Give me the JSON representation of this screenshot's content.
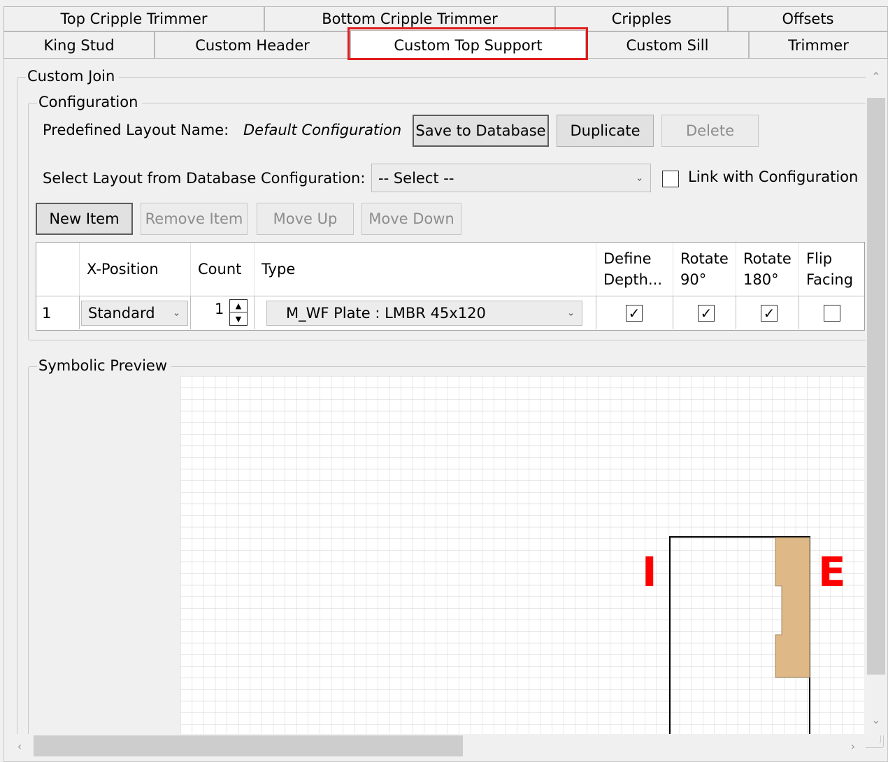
{
  "tabs_row1": [
    "Top Cripple Trimmer",
    "Bottom Cripple Trimmer",
    "Cripples",
    "Offsets"
  ],
  "tabs_row2": [
    "King Stud",
    "Custom Header",
    "Custom Top Support",
    "Custom Sill",
    "Trimmer"
  ],
  "active_tab": "Custom Top Support",
  "custom_join": {
    "legend": "Custom Join",
    "configuration": {
      "legend": "Configuration",
      "predefined_label": "Predefined Layout Name:",
      "predefined_value": "Default Configuration",
      "save_button": "Save to Database",
      "duplicate_button": "Duplicate",
      "delete_button": "Delete",
      "select_label": "Select Layout from Database Configuration:",
      "select_value": "-- Select --",
      "link_label": "Link with Configuration",
      "link_checked": false,
      "new_item": "New Item",
      "remove_item": "Remove Item",
      "move_up": "Move Up",
      "move_down": "Move Down",
      "table": {
        "headers": {
          "x_position": "X-Position",
          "count": "Count",
          "type": "Type",
          "define_depth_1": "Define",
          "define_depth_2": "Depth...",
          "rotate90_1": "Rotate",
          "rotate90_2": "90°",
          "rotate180_1": "Rotate",
          "rotate180_2": "180°",
          "flip_1": "Flip",
          "flip_2": "Facing"
        },
        "rows": [
          {
            "index": "1",
            "x_position": "Standard",
            "count": "1",
            "type": "M_WF Plate : LMBR 45x120",
            "define_depth": true,
            "rotate90": true,
            "rotate180": true,
            "flip_facing": false
          }
        ]
      }
    },
    "preview": {
      "legend": "Symbolic Preview",
      "interior_label": "I",
      "exterior_label": "E",
      "label_color": "#ff0000",
      "member_color": "#deb887"
    }
  },
  "colors": {
    "highlight": "#e01c1c"
  }
}
